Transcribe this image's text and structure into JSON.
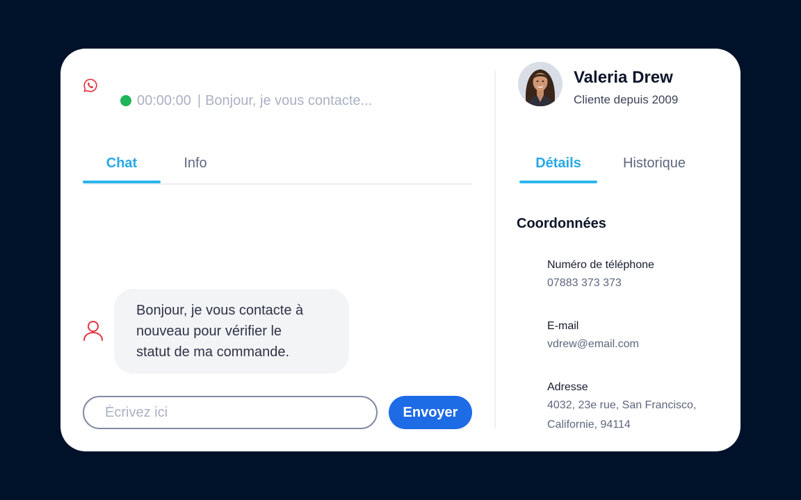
{
  "conversation": {
    "channel_icon": "whatsapp-icon",
    "status_color": "#1fb457",
    "timer": "00:00:00",
    "separator": "|",
    "preview": "Bonjour, je vous contacte..."
  },
  "left_tabs": [
    {
      "label": "Chat",
      "active": true
    },
    {
      "label": "Info",
      "active": false
    }
  ],
  "message": {
    "sender_icon": "user-icon",
    "lines": [
      "Bonjour, je vous contacte à",
      "nouveau pour vérifier le",
      "statut de ma commande."
    ]
  },
  "composer": {
    "placeholder": "Écrivez ici",
    "send_label": "Envoyer"
  },
  "customer": {
    "name": "Valeria Drew",
    "since": "Cliente depuis 2009"
  },
  "right_tabs": [
    {
      "label": "Détails",
      "active": true
    },
    {
      "label": "Historique",
      "active": false
    }
  ],
  "contact": {
    "title": "Coordonnées",
    "phone_label": "Numéro de téléphone",
    "phone": "07883 373 373",
    "email_label": "E-mail",
    "email": "vdrew@email.com",
    "address_label": "Adresse",
    "address_lines": [
      "4032, 23e rue, San Francisco,",
      "Californie, 94114"
    ]
  },
  "colors": {
    "background": "#00112a",
    "accent_tab": "#27a8e6",
    "send_button": "#1e6be6",
    "icon_red": "#e0343f"
  }
}
